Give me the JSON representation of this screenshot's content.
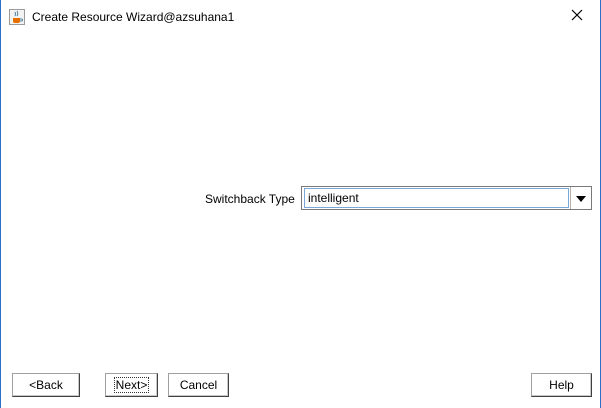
{
  "window": {
    "title": "Create Resource Wizard@azsuhana1",
    "app_icon": "java-coffee-icon",
    "close_icon": "close-icon"
  },
  "form": {
    "switchback_label": "Switchback Type",
    "switchback_value": "intelligent"
  },
  "buttons": {
    "back": "<Back",
    "next": "Next>",
    "cancel": "Cancel",
    "help": "Help"
  },
  "colors": {
    "window_border": "#2b6fc9",
    "combo_focus": "#7aa7d8"
  }
}
